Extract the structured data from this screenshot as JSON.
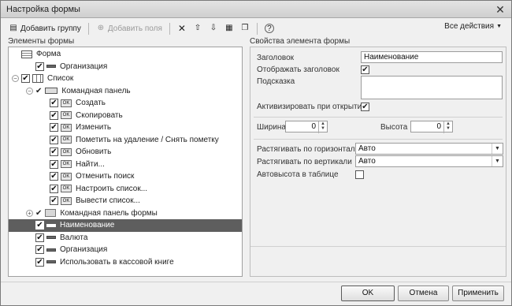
{
  "window": {
    "title": "Настройка формы",
    "close": "✕"
  },
  "toolbar": {
    "add_group": "Добавить группу",
    "add_fields": "Добавить поля",
    "all_actions": "Все действия",
    "icons": [
      "add-group-icon",
      "add-fields-icon",
      "delete-icon",
      "move-up-icon",
      "move-down-icon",
      "group-icon",
      "copy-icon",
      "help-icon"
    ]
  },
  "left": {
    "title": "Элементы формы"
  },
  "tree": [
    {
      "label": "Форма",
      "indent": 0,
      "icon": "form",
      "check": "none",
      "expander": ""
    },
    {
      "label": "Организация",
      "indent": 1,
      "icon": "field",
      "check": "box",
      "expander": ""
    },
    {
      "label": "Список",
      "indent": 0,
      "icon": "table",
      "check": "box",
      "expander": "−"
    },
    {
      "label": "Командная панель",
      "indent": 1,
      "icon": "panel",
      "check": "mark",
      "expander": "−"
    },
    {
      "label": "Создать",
      "indent": 2,
      "icon": "ok",
      "check": "box",
      "expander": ""
    },
    {
      "label": "Скопировать",
      "indent": 2,
      "icon": "ok",
      "check": "box",
      "expander": ""
    },
    {
      "label": "Изменить",
      "indent": 2,
      "icon": "ok",
      "check": "box",
      "expander": ""
    },
    {
      "label": "Пометить на удаление / Снять пометку",
      "indent": 2,
      "icon": "ok",
      "check": "box",
      "expander": ""
    },
    {
      "label": "Обновить",
      "indent": 2,
      "icon": "ok",
      "check": "box",
      "expander": ""
    },
    {
      "label": "Найти...",
      "indent": 2,
      "icon": "ok",
      "check": "box",
      "expander": ""
    },
    {
      "label": "Отменить поиск",
      "indent": 2,
      "icon": "ok",
      "check": "box",
      "expander": ""
    },
    {
      "label": "Настроить список...",
      "indent": 2,
      "icon": "ok",
      "check": "box",
      "expander": ""
    },
    {
      "label": "Вывести список...",
      "indent": 2,
      "icon": "ok",
      "check": "box",
      "expander": ""
    },
    {
      "label": "Командная панель формы",
      "indent": 1,
      "icon": "folder",
      "check": "mark",
      "expander": "+"
    },
    {
      "label": "Наименование",
      "indent": 1,
      "icon": "field",
      "check": "box",
      "expander": "",
      "selected": true
    },
    {
      "label": "Валюта",
      "indent": 1,
      "icon": "field",
      "check": "box",
      "expander": ""
    },
    {
      "label": "Организация",
      "indent": 1,
      "icon": "field",
      "check": "box",
      "expander": ""
    },
    {
      "label": "Использовать в кассовой книге",
      "indent": 1,
      "icon": "field",
      "check": "box",
      "expander": ""
    }
  ],
  "props": {
    "title": "Свойства элемента формы",
    "caption_label": "Заголовок",
    "caption_value": "Наименование",
    "show_caption_label": "Отображать заголовок",
    "show_caption_checked": "✔",
    "hint_label": "Подсказка",
    "activate_label": "Активизировать при открытии",
    "activate_checked": "✔",
    "width_label": "Ширина",
    "width_value": "0",
    "height_label": "Высота",
    "height_value": "0",
    "stretch_h_label": "Растягивать по горизонтали",
    "stretch_h_value": "Авто",
    "stretch_v_label": "Растягивать по вертикали",
    "stretch_v_value": "Авто",
    "autoheight_label": "Автовысота в таблице",
    "autoheight_checked": ""
  },
  "buttons": {
    "ok": "OK",
    "cancel": "Отмена",
    "apply": "Применить"
  }
}
